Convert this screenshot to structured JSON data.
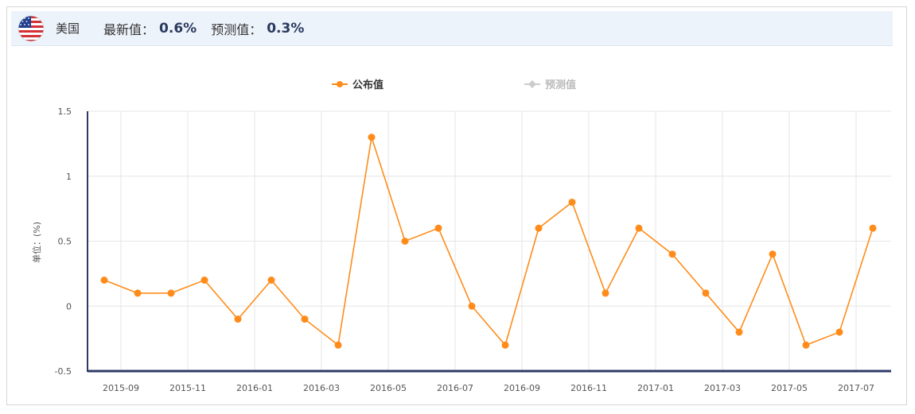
{
  "header": {
    "country": "美国",
    "latest_label": "最新值：",
    "latest_value": "0.6%",
    "forecast_label": "预测值：",
    "forecast_value": "0.3%",
    "flag_icon": "us-flag-icon"
  },
  "colors": {
    "published": "#ff8c1a",
    "forecast": "#cccccc",
    "axis": "#2f3b66",
    "grid": "#e6e6e6"
  },
  "chart_data": {
    "type": "line",
    "title": "",
    "xlabel": "",
    "ylabel": "单位：(%)",
    "ylim": [
      -0.5,
      1.5
    ],
    "y_ticks": [
      "1.5",
      "1",
      "0.5",
      "0",
      "-0.5"
    ],
    "x_tick_labels": [
      "2015-09",
      "2015-11",
      "2016-01",
      "2016-03",
      "2016-05",
      "2016-07",
      "2016-09",
      "2016-11",
      "2017-01",
      "2017-03",
      "2017-05",
      "2017-07"
    ],
    "x": [
      "2015-09",
      "2015-10",
      "2015-11",
      "2015-12",
      "2016-01",
      "2016-02",
      "2016-03",
      "2016-04",
      "2016-05",
      "2016-06",
      "2016-07",
      "2016-08",
      "2016-09",
      "2016-10",
      "2016-11",
      "2016-12",
      "2017-01",
      "2017-02",
      "2017-03",
      "2017-04",
      "2017-05",
      "2017-06",
      "2017-07",
      "2017-08"
    ],
    "legend_position": "top-center",
    "grid": true,
    "series": [
      {
        "name": "公布值",
        "values": [
          0.2,
          0.1,
          0.1,
          0.2,
          -0.1,
          0.2,
          -0.1,
          -0.3,
          1.3,
          0.5,
          0.6,
          0.0,
          -0.3,
          0.6,
          0.8,
          0.1,
          0.6,
          0.4,
          0.1,
          -0.2,
          0.4,
          -0.3,
          -0.2,
          0.6
        ]
      },
      {
        "name": "预测值",
        "values": []
      }
    ]
  }
}
